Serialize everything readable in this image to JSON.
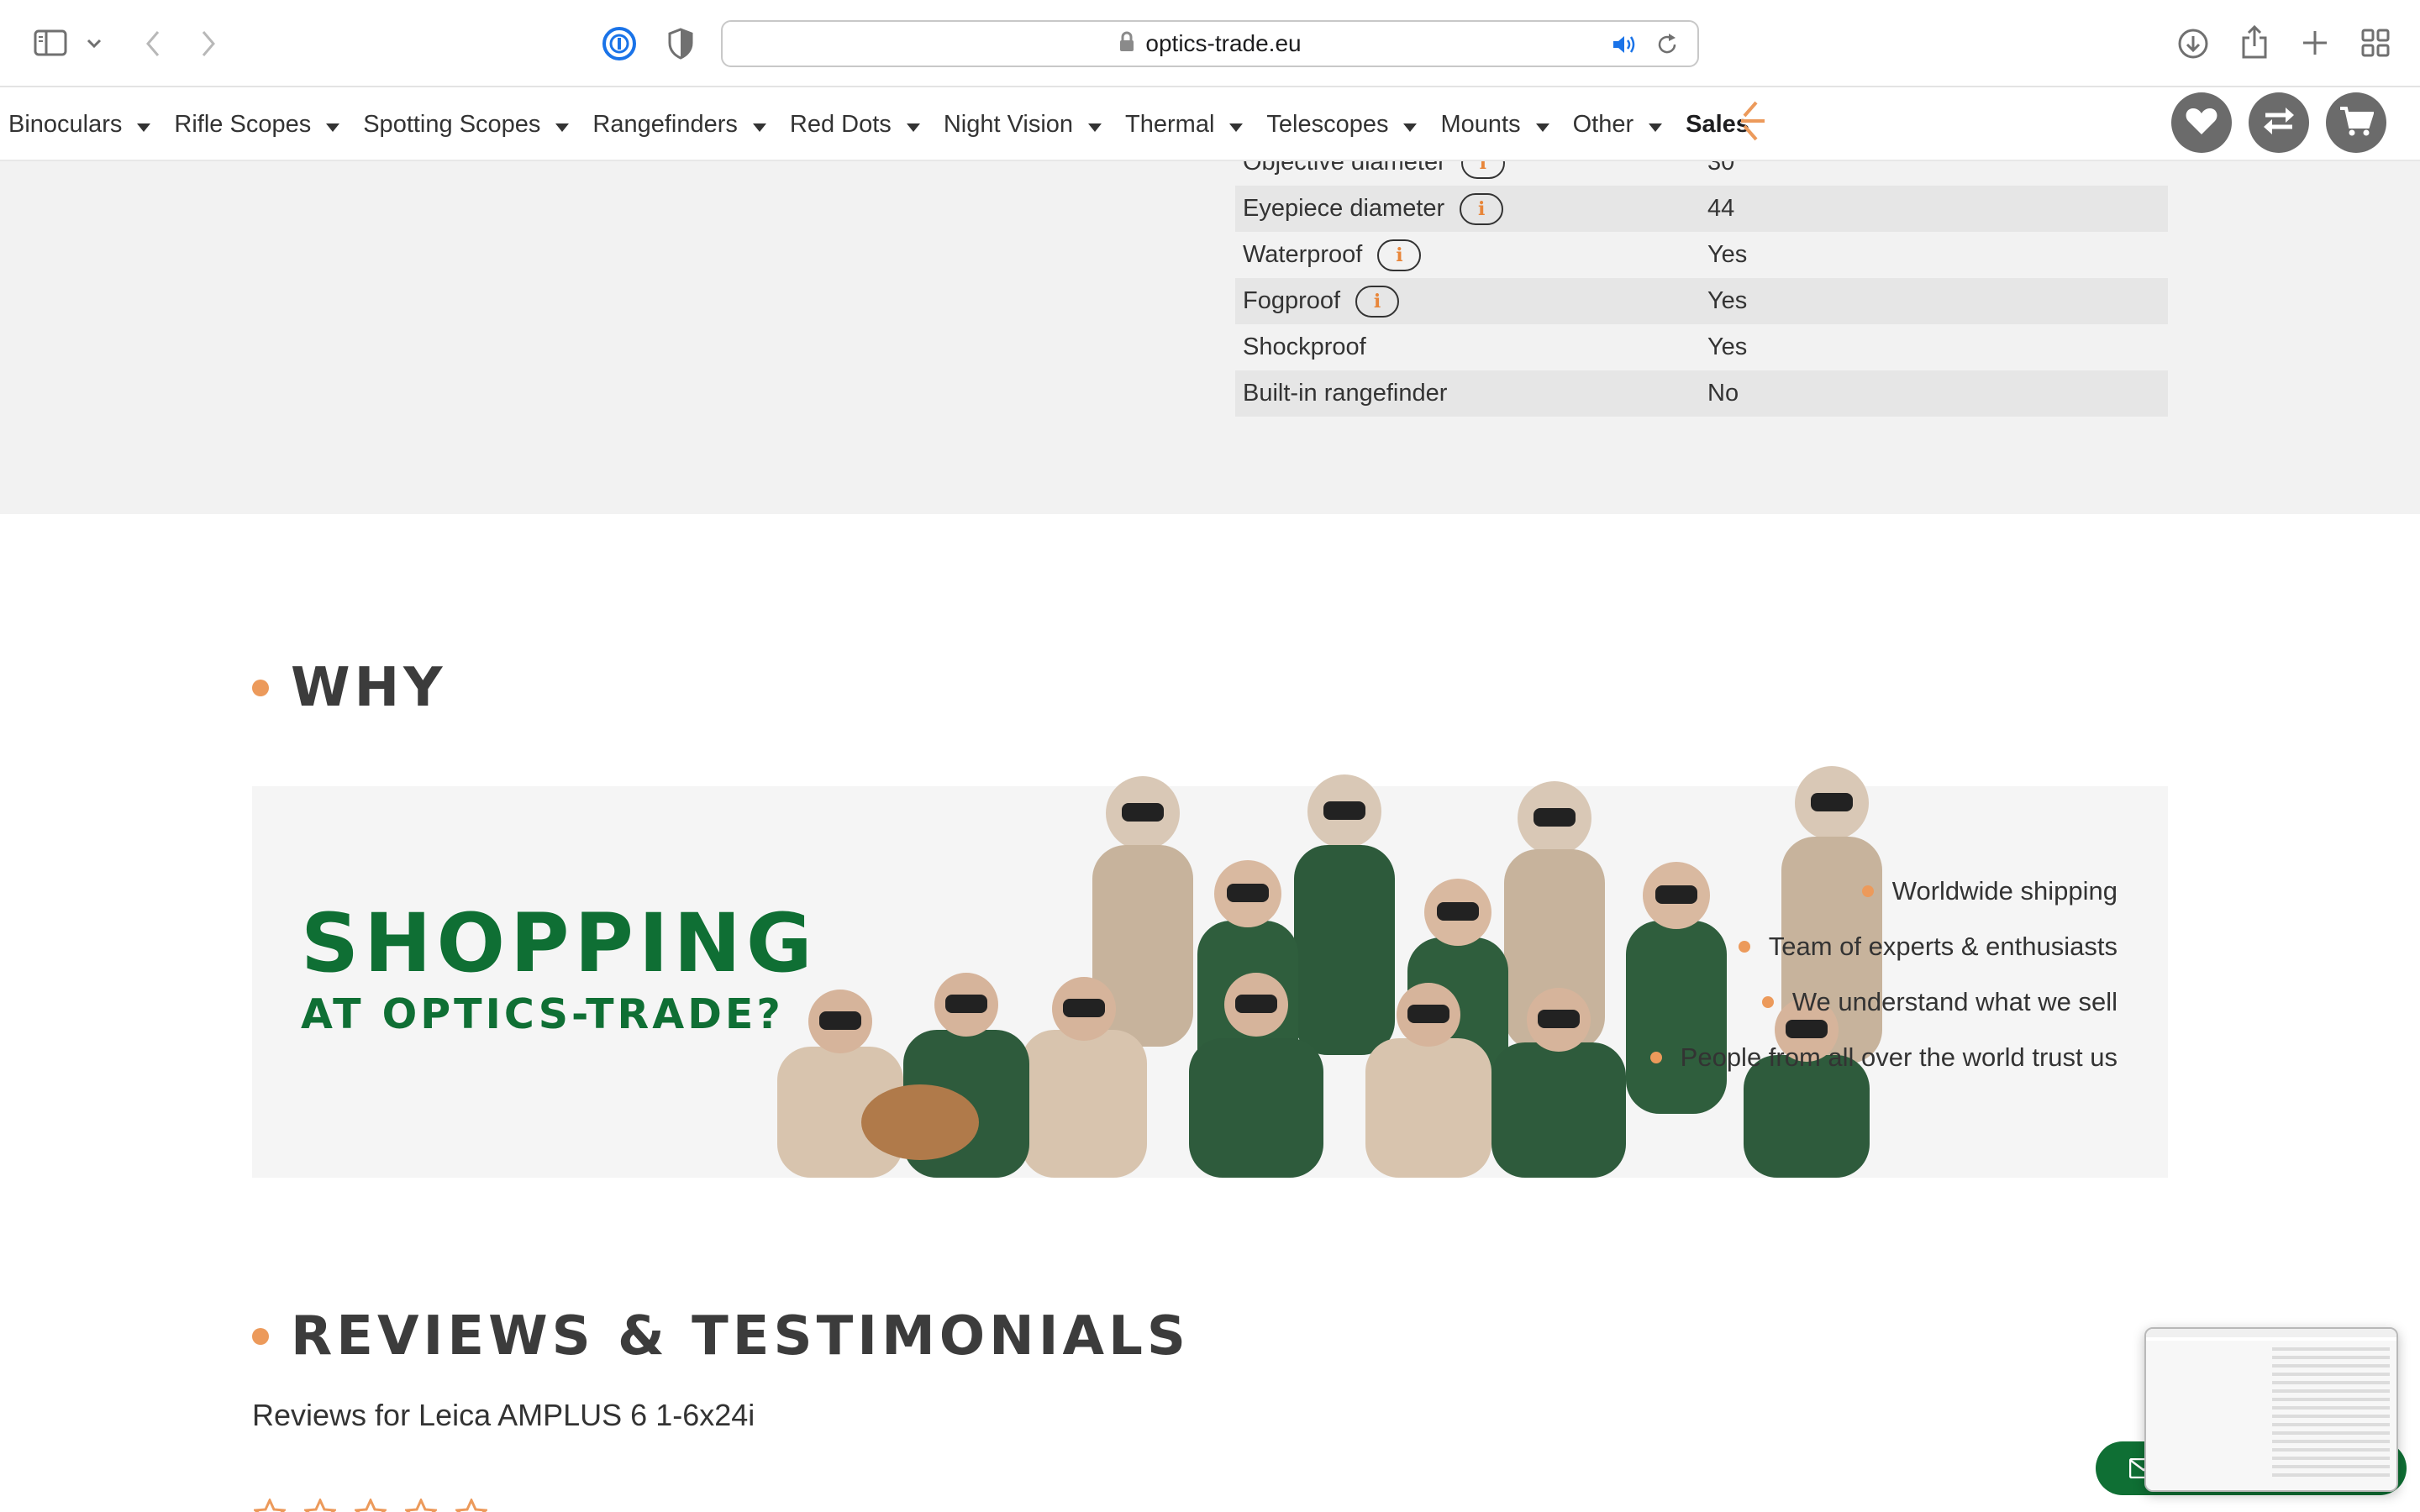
{
  "browser": {
    "url": "optics-trade.eu",
    "icons": [
      "sidebar-icon",
      "chevron-down-icon",
      "back-icon",
      "forward-icon",
      "password-manager-icon",
      "privacy-shield-icon",
      "lock-icon",
      "speaker-icon",
      "reload-icon",
      "download-icon",
      "share-icon",
      "new-tab-icon",
      "tab-overview-icon"
    ]
  },
  "nav": {
    "items": [
      {
        "label": "Binoculars"
      },
      {
        "label": "Rifle Scopes"
      },
      {
        "label": "Spotting Scopes"
      },
      {
        "label": "Rangefinders"
      },
      {
        "label": "Red Dots"
      },
      {
        "label": "Night Vision"
      },
      {
        "label": "Thermal"
      },
      {
        "label": "Telescopes"
      },
      {
        "label": "Mounts"
      },
      {
        "label": "Other"
      }
    ],
    "sales": "Sales",
    "icons": [
      "wishlist-heart-icon",
      "compare-icon",
      "cart-icon"
    ]
  },
  "specs": {
    "rows": [
      {
        "label": "Objective diameter",
        "value": "30",
        "info": "i"
      },
      {
        "label": "Eyepiece diameter",
        "value": "44",
        "info": "i"
      },
      {
        "label": "Waterproof",
        "value": "Yes",
        "info": "i"
      },
      {
        "label": "Fogproof",
        "value": "Yes",
        "info": "i"
      },
      {
        "label": "Shockproof",
        "value": "Yes"
      },
      {
        "label": "Built-in rangefinder",
        "value": "No"
      }
    ]
  },
  "why": {
    "heading": "WHY",
    "title_line1": "SHOPPING",
    "title_line2": "AT OPTICS-TRADE?",
    "benefits": [
      "Worldwide shipping",
      "Team of experts & enthusiasts",
      "We understand what we sell",
      "People from all over the world trust us"
    ]
  },
  "reviews": {
    "heading": "REVIEWS & TESTIMONIALS",
    "subtitle": "Reviews for Leica AMPLUS 6 1-6x24i",
    "rating": 5
  },
  "colors": {
    "brand_green": "#0f6f34",
    "accent_orange": "#ec9a5b",
    "info_orange": "#e8863a",
    "nav_button_gray": "#6b6b6b"
  }
}
